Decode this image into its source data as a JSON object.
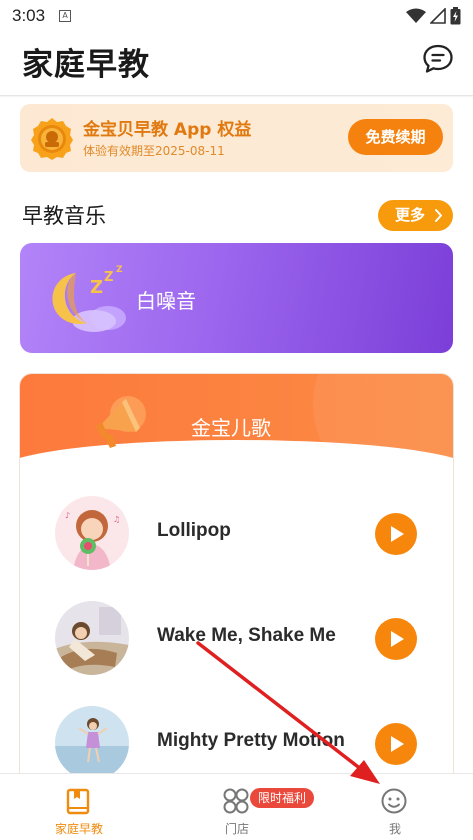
{
  "status_bar": {
    "time": "3:03"
  },
  "header": {
    "title": "家庭早教"
  },
  "vip_card": {
    "title": "金宝贝早教 App 权益",
    "expiry": "体验有效期至2025-08-11",
    "renew_label": "免费续期"
  },
  "music_section": {
    "title": "早教音乐",
    "more_label": "更多"
  },
  "white_noise": {
    "label": "白噪音"
  },
  "songs_card": {
    "title": "金宝儿歌",
    "songs": [
      {
        "name": "Lollipop"
      },
      {
        "name": "Wake Me, Shake Me"
      },
      {
        "name": "Mighty Pretty Motion"
      }
    ]
  },
  "tab_bar": {
    "tabs": [
      {
        "label": "家庭早教",
        "icon": "book-icon",
        "active": true
      },
      {
        "label": "门店",
        "icon": "grid-icon",
        "badge": "限时福利",
        "active": false
      },
      {
        "label": "我",
        "icon": "smile-face-icon",
        "active": false
      }
    ]
  },
  "colors": {
    "accent": "#f7870c",
    "vip_bg": "#fde9d3",
    "noise_gradient_start": "#b284f8",
    "noise_gradient_end": "#7b3fd8",
    "songs_header": "#fd7a3c",
    "badge_red": "#e9483b",
    "annotation_arrow": "#e02020"
  }
}
